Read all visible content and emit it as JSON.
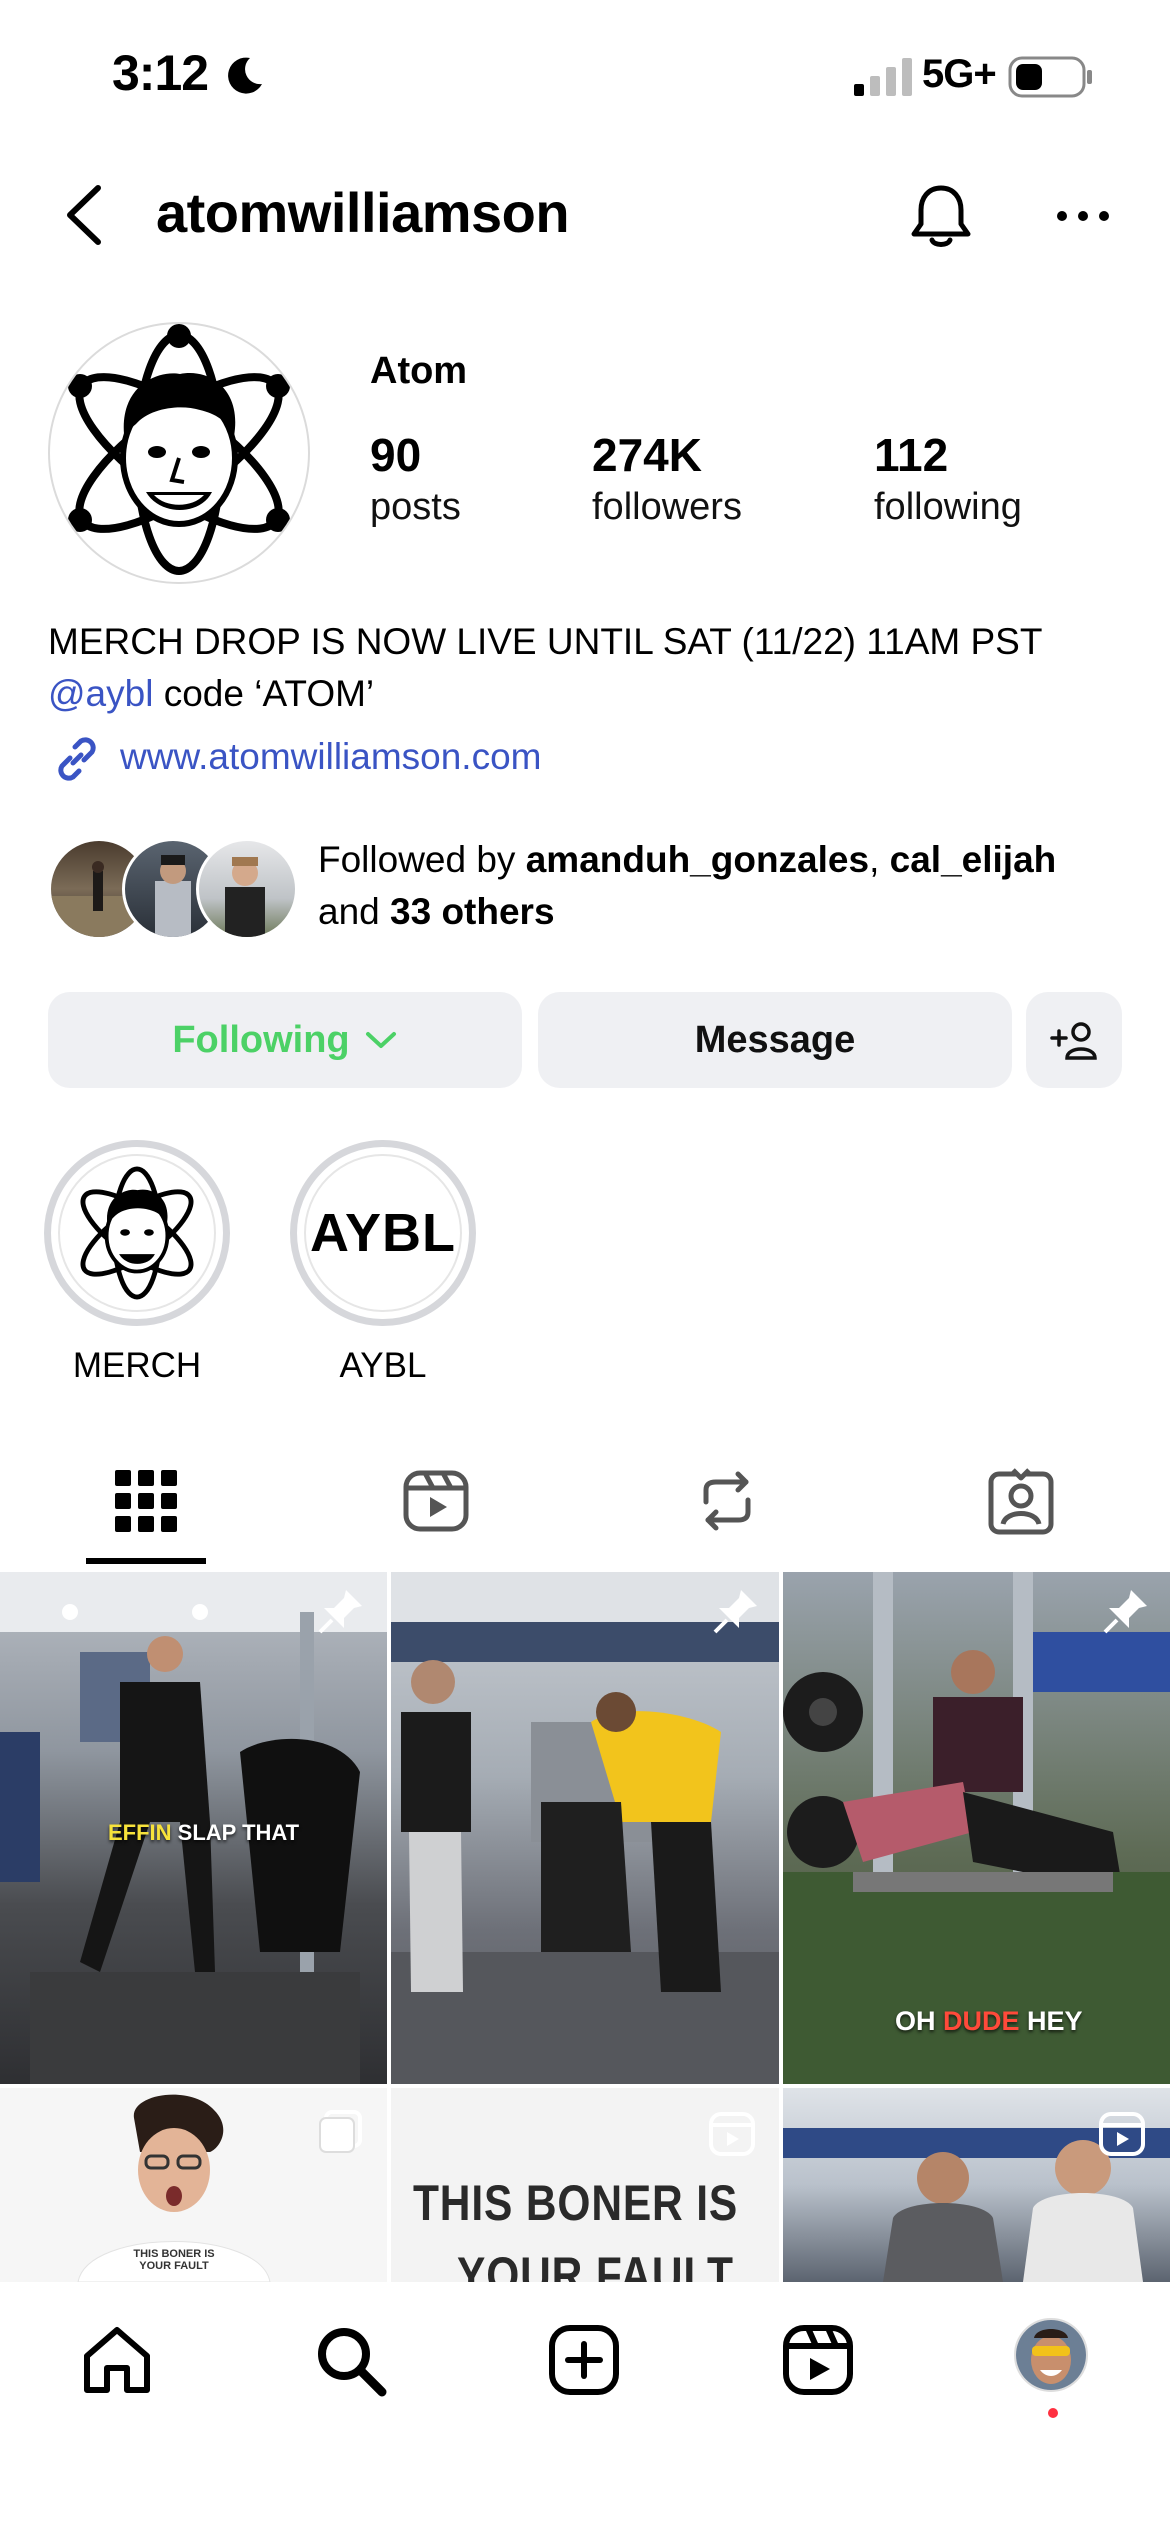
{
  "status_bar": {
    "time": "3:12",
    "network": "5G+",
    "icons": [
      "moon-icon",
      "signal-icon",
      "battery-icon"
    ]
  },
  "header": {
    "username": "atomwilliamson",
    "icons": [
      "back-icon",
      "bell-icon",
      "more-icon"
    ]
  },
  "profile": {
    "display_name": "Atom",
    "stats": [
      {
        "value": "90",
        "label": "posts"
      },
      {
        "value": "274K",
        "label": "followers"
      },
      {
        "value": "112",
        "label": "following"
      }
    ],
    "bio_line1": "MERCH DROP IS NOW LIVE UNTIL SAT (11/22) 11AM PST",
    "bio_mention": "@aybl",
    "bio_line2_rest": " code ‘ATOM’",
    "link": "www.atomwilliamson.com",
    "followed_by_prefix": "Followed by ",
    "followed_by_user1": "amanduh_gonzales",
    "followed_by_sep": ", ",
    "followed_by_user2": "cal_elijah",
    "followed_by_and": "and ",
    "followed_by_others": "33 others"
  },
  "actions": {
    "following_label": "Following",
    "message_label": "Message"
  },
  "highlights": [
    {
      "label": "MERCH"
    },
    {
      "label": "AYBL",
      "logo_text": "AYBL"
    }
  ],
  "tabs": [
    "posts-grid",
    "reels",
    "reposts",
    "tagged"
  ],
  "grid_captions": {
    "post1_a": "EFFIN",
    "post1_b": " SLAP THAT",
    "post3_a": "OH ",
    "post3_b": "DUDE",
    "post3_c": " HEY",
    "post4_shirt": "THIS BONER IS YOUR FAULT",
    "post5_line1": "THIS BONER IS",
    "post5_line2": "YOUR FAULT"
  },
  "colors": {
    "link": "#3a54c4",
    "following_green": "#4cd166",
    "button_bg": "#eff0f3",
    "notification_dot": "#ff3040"
  },
  "bottom_nav": [
    "home-icon",
    "search-icon",
    "create-icon",
    "reels-icon",
    "profile-avatar"
  ]
}
